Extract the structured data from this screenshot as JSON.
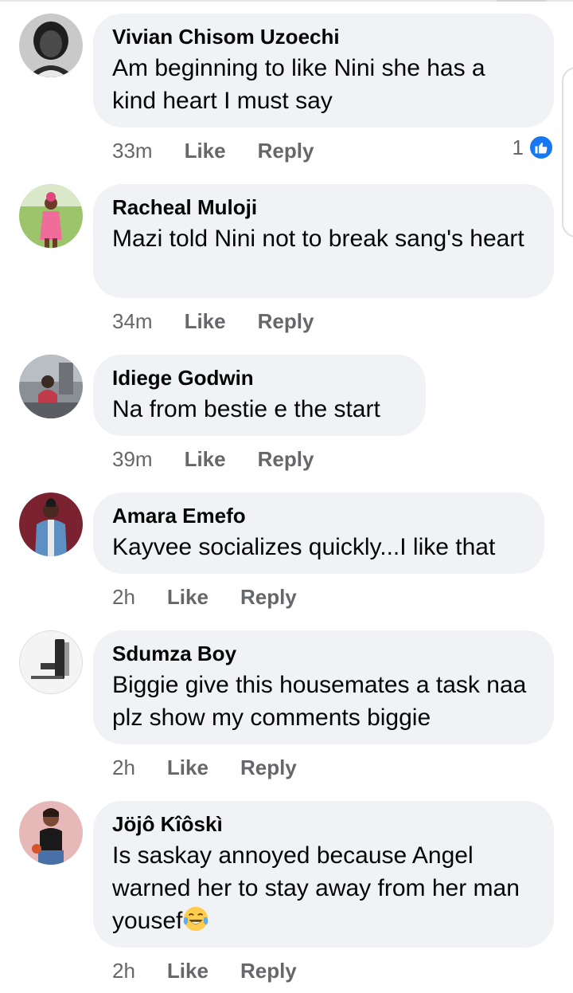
{
  "comments": [
    {
      "author": "Vivian Chisom Uzoechi",
      "text": "Am beginning to like Nini she has a kind heart I must say",
      "time": "33m",
      "like_label": "Like",
      "reply_label": "Reply",
      "reaction_count": "1",
      "reaction_icon": "like-icon"
    },
    {
      "author": "Racheal Muloji",
      "text": "Mazi told Nini not to break sang's heart",
      "time": "34m",
      "like_label": "Like",
      "reply_label": "Reply"
    },
    {
      "author": "Idiege Godwin",
      "text": "Na from bestie e the start",
      "time": "39m",
      "like_label": "Like",
      "reply_label": "Reply"
    },
    {
      "author": "Amara Emefo",
      "text": "Kayvee socializes quickly...I like that",
      "time": "2h",
      "like_label": "Like",
      "reply_label": "Reply"
    },
    {
      "author": "Sdumza Boy",
      "text": "Biggie give this housemates a task naa plz show my comments biggie",
      "time": "2h",
      "like_label": "Like",
      "reply_label": "Reply"
    },
    {
      "author": "Jöjô Kîôskì",
      "text": "Is saskay annoyed because Angel warned her to stay away from her man yousef",
      "text_emoji": "face-with-tears-of-joy",
      "time": "2h",
      "like_label": "Like",
      "reply_label": "Reply"
    }
  ],
  "colors": {
    "bubble": "#f0f2f5",
    "secondary_text": "#65676b",
    "like_blue": "#1877f2"
  }
}
